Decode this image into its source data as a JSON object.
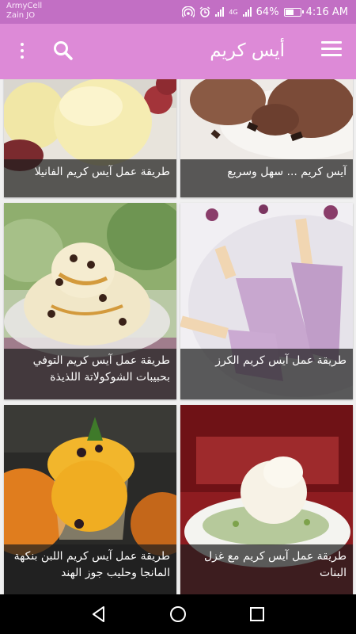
{
  "status_bar": {
    "carrier_1": "ArmyCell",
    "carrier_2": "Zain JO",
    "network_label": "4G",
    "battery": "64%",
    "battery_level": 0.64,
    "time": "4:16 AM"
  },
  "app_bar": {
    "title": "أيس كريم",
    "icons": [
      "menu-icon",
      "search-icon",
      "more-vert-icon"
    ]
  },
  "recipes": [
    {
      "title": "آيس كريم ... سهل وسريع"
    },
    {
      "title": "طريقة عمل آيس كريم الفانيلا"
    },
    {
      "title": "طريقة عمل آيس كريم الكرز"
    },
    {
      "title": "طريقة عمل آيس كريم التوفي بحبيبات الشوكولاتة اللذيذة"
    },
    {
      "title": "طريقة عمل آيس كريم مع غزل البنات"
    },
    {
      "title": "طريقة عمل آيس كريم اللبن بنكهة المانجا وحليب جوز الهند"
    }
  ],
  "nav_bar": {
    "icons": [
      "back-icon",
      "home-icon",
      "recents-icon"
    ]
  },
  "colors": {
    "status_bar": "#c26fc4",
    "app_bar": "#dd8ad7",
    "caption_overlay": "#1e1e1e",
    "nav_bar": "#000000"
  }
}
